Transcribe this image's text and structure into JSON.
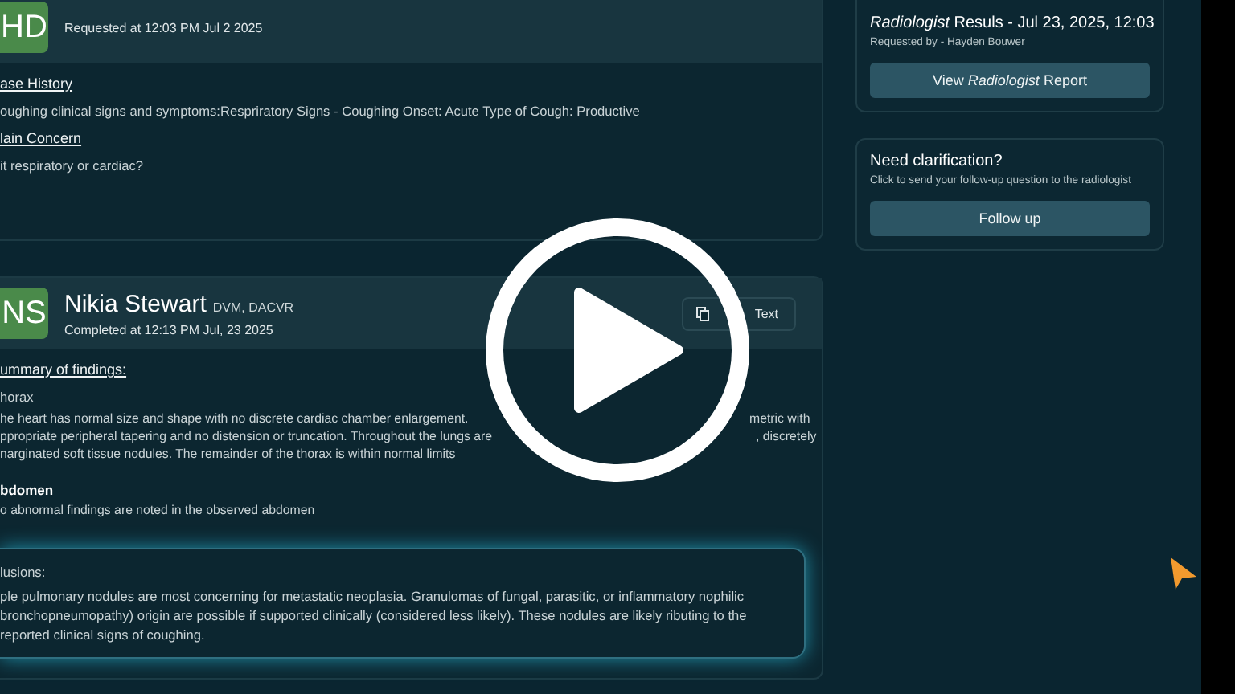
{
  "request_card": {
    "avatar": "HD",
    "subtitle": "Requested at 12:03 PM Jul 2 2025",
    "sections": [
      {
        "heading": "ase History",
        "body": "oughing clinical signs and symptoms:Respriratory Signs - Coughing Onset: Acute Type of Cough: Productive"
      },
      {
        "heading": "lain Concern",
        "body": " it respiratory or cardiac?"
      }
    ]
  },
  "report_card": {
    "avatar": "NS",
    "name": "Nikia Stewart",
    "credentials": "DVM, DACVR",
    "subtitle": "Completed at 12:13 PM Jul, 23 2025",
    "copy_button": "Text",
    "summary_heading": "ummary of findings:",
    "findings": [
      {
        "title": "horax",
        "lines": [
          [
            "he heart has normal size and shape with no discrete cardiac chamber enlargement.",
            "metric with"
          ],
          [
            "ppropriate peripheral tapering and no distension or truncation. Throughout the lungs are",
            ", discretely"
          ],
          [
            "narginated soft tissue nodules. The remainder of the thorax is within normal limits"
          ]
        ]
      },
      {
        "title": "bdomen",
        "lines": [
          [
            "o abnormal findings are noted in the observed abdomen"
          ]
        ]
      }
    ],
    "conclusions": {
      "title": "lusions:",
      "body": "ple pulmonary nodules are most concerning for metastatic neoplasia. Granulomas of fungal, parasitic, or inflammatory nophilic bronchopneumopathy) origin are possible if supported clinically (considered less likely). These nodules are likely ributing to the reported clinical signs of coughing."
    }
  },
  "results_card": {
    "title": "*Radiologist* Resuls - Jul 23, 2025, 12:03",
    "requested_by": "Requested by - Hayden Bouwer",
    "button": "View *Radiologist* Report"
  },
  "clarification_card": {
    "title": "Need clarification?",
    "hint": "Click to send your follow-up question to the radiologist",
    "button": "Follow up"
  }
}
